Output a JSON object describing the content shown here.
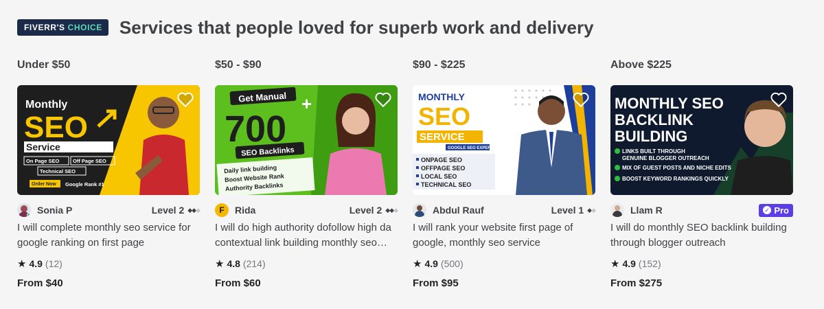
{
  "header": {
    "badge_prefix": "FIVERR'S",
    "badge_suffix": "CHOICE",
    "title": "Services that people loved for superb work and delivery"
  },
  "columns": [
    {
      "range": "Under $50",
      "image": {
        "l1": "Monthly",
        "l2": "SEO",
        "l3": "Service",
        "t1": "On Page SEO",
        "t2": "Off Page SEO",
        "t3": "Technical SEO",
        "t4": "Order Now",
        "t5": "Google Rank #1"
      },
      "seller": "Sonia P",
      "level": "Level 2",
      "description": "I will complete monthly seo service for google ranking on first page",
      "rating": "4.9",
      "reviews": "(12)",
      "price": "From $40"
    },
    {
      "range": "$50 - $90",
      "image": {
        "l1": "Get Manual",
        "l2": "700",
        "l3": "SEO Backlinks",
        "t1": "Daily link building",
        "t2": "Boost Website Rank",
        "t3": "Authority Backlinks"
      },
      "seller": "Rida",
      "level": "Level 2",
      "description": "I will do high authority dofollow high da contextual link building monthly seo backlinks",
      "rating": "4.8",
      "reviews": "(214)",
      "price": "From $60"
    },
    {
      "range": "$90 - $225",
      "image": {
        "l1": "MONTHLY",
        "l2": "SEO",
        "l3": "SERVICE",
        "l4": "GOOGLE SEO EXPERT",
        "t1": "ONPAGE SEO",
        "t2": "OFFPAGE SEO",
        "t3": "LOCAL SEO",
        "t4": "TECHNICAL SEO"
      },
      "seller": "Abdul Rauf",
      "level": "Level 1",
      "description": "I will rank your website first page of google, monthly seo service",
      "rating": "4.9",
      "reviews": "(500)",
      "price": "From $95"
    },
    {
      "range": "Above $225",
      "image": {
        "l1": "MONTHLY SEO",
        "l2": "BACKLINK",
        "l3": "BUILDING",
        "t1": "LINKS BUILT THROUGH",
        "t1b": "GENUINE BLOGGER OUTREACH",
        "t2": "MIX OF GUEST POSTS AND NICHE EDITS",
        "t3": "BOOST KEYWORD RANKINGS QUICKLY"
      },
      "seller": "Llam R",
      "pro": "Pro",
      "description": "I will do monthly SEO backlink building through blogger outreach",
      "rating": "4.9",
      "reviews": "(152)",
      "price": "From $275"
    }
  ],
  "colors": {
    "badge_bg": "#1c2a4a",
    "badge_accent": "#5bd9b6",
    "pro_bg": "#5b3ee6",
    "level_off": "#c5c6c9"
  },
  "icons": [
    "heart-icon",
    "star-icon",
    "diamond-icon",
    "check-icon"
  ]
}
